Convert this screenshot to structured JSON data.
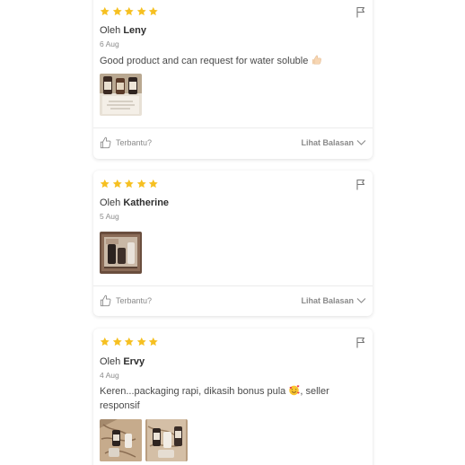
{
  "colors": {
    "star": "#f6c021",
    "text": "#4a4a4a",
    "muted": "#8b8b8b"
  },
  "reviews": [
    {
      "rating": 5,
      "author_prefix": "Oleh",
      "author_name": "Leny",
      "date": "6 Aug",
      "text": "Good product and can request for water soluble",
      "emoji": "thumbs-up",
      "photo_count": 1,
      "helpful_label": "Terbantu?",
      "replies_label": "Lihat Balasan"
    },
    {
      "rating": 5,
      "author_prefix": "Oleh",
      "author_name": "Katherine",
      "date": "5 Aug",
      "text": "",
      "photo_count": 1,
      "helpful_label": "Terbantu?",
      "replies_label": "Lihat Balasan"
    },
    {
      "rating": 5,
      "author_prefix": "Oleh",
      "author_name": "Ervy",
      "date": "4 Aug",
      "text_line1": "Keren...packaging rapi, dikasih bonus pula",
      "emoji": "smiling-face-with-hearts",
      "text_line1_tail": ", seller",
      "text_line2": "responsif",
      "photo_count": 2
    }
  ]
}
